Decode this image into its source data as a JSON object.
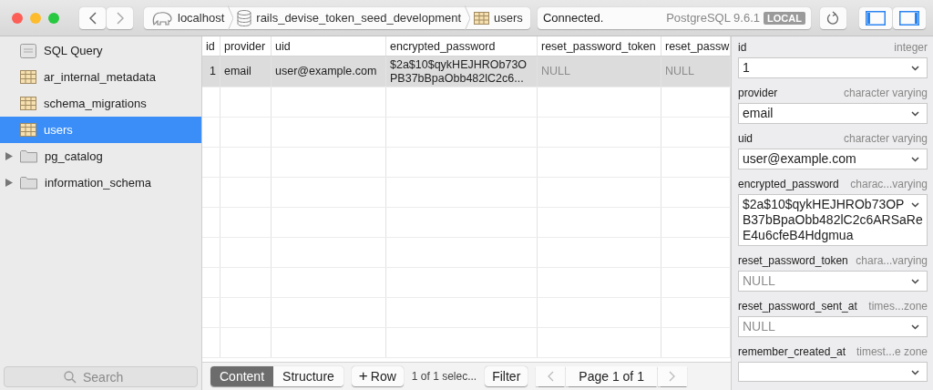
{
  "toolbar": {
    "breadcrumbs": [
      {
        "kind": "server",
        "label": "localhost"
      },
      {
        "kind": "database",
        "label": "rails_devise_token_seed_development"
      },
      {
        "kind": "table",
        "label": "users"
      }
    ],
    "status": "Connected.",
    "server_version": "PostgreSQL 9.6.1",
    "server_badge": "LOCAL",
    "left_pane_on": true,
    "right_pane_on": true
  },
  "sidebar": {
    "items": [
      {
        "kind": "query",
        "label": "SQL Query",
        "selected": false
      },
      {
        "kind": "table",
        "label": "ar_internal_metadata",
        "selected": false
      },
      {
        "kind": "table",
        "label": "schema_migrations",
        "selected": false
      },
      {
        "kind": "table",
        "label": "users",
        "selected": true
      },
      {
        "kind": "folder",
        "label": "pg_catalog",
        "selected": false,
        "expanded": false
      },
      {
        "kind": "folder",
        "label": "information_schema",
        "selected": false,
        "expanded": false
      }
    ],
    "search": {
      "placeholder": "Search"
    }
  },
  "table": {
    "columns": [
      "id",
      "provider",
      "uid",
      "encrypted_password",
      "reset_password_token",
      "reset_passw"
    ],
    "rows": [
      {
        "selected": true,
        "cells": [
          {
            "text": "1",
            "null": false
          },
          {
            "text": "email",
            "null": false
          },
          {
            "text": "user@example.com",
            "null": false
          },
          {
            "text": "$2a$10$qykHEJHROb73O PB37bBpaObb482lC2c6...",
            "null": false
          },
          {
            "text": "NULL",
            "null": true
          },
          {
            "text": "NULL",
            "null": true
          }
        ]
      }
    ]
  },
  "bottom_bar": {
    "tabs": [
      {
        "label": "Content",
        "selected": true
      },
      {
        "label": "Structure",
        "selected": false
      }
    ],
    "add_row": "Row",
    "add_icon": "+",
    "selection": "1 of 1 selec...",
    "filter": "Filter",
    "page": "Page 1 of 1"
  },
  "inspector": {
    "fields": [
      {
        "label": "id",
        "type": "integer",
        "value": "1",
        "null": false
      },
      {
        "label": "provider",
        "type": "character varying",
        "value": "email",
        "null": false
      },
      {
        "label": "uid",
        "type": "character varying",
        "value": "user@example.com",
        "null": false
      },
      {
        "label": "encrypted_password",
        "type": "charac...varying",
        "value": "$2a$10$qykHEJHROb73OP B37bBpaObb482lC2c6ARSaRe E4u6cfeB4Hdgmua",
        "null": false
      },
      {
        "label": "reset_password_token",
        "type": "chara...varying",
        "value": "NULL",
        "null": true
      },
      {
        "label": "reset_password_sent_at",
        "type": "times...zone",
        "value": "NULL",
        "null": true
      },
      {
        "label": "remember_created_at",
        "type": "timest...e zone"
      }
    ]
  }
}
